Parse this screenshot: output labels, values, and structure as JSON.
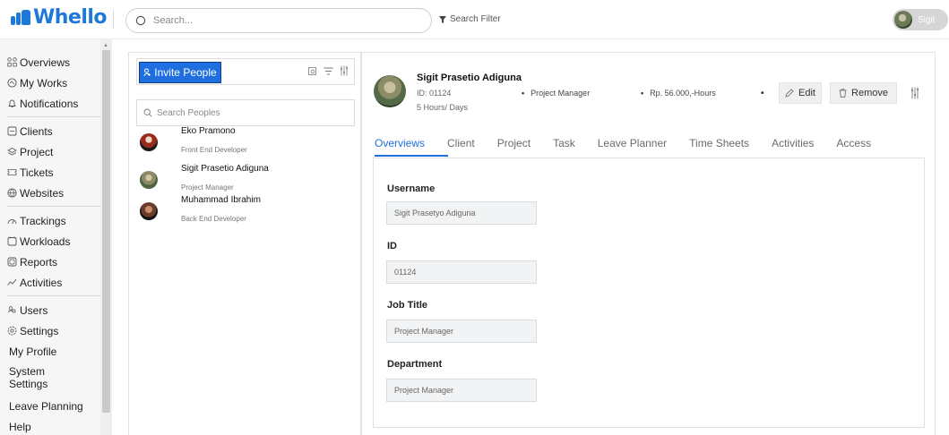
{
  "app": {
    "brand": "Whello",
    "search_placeholder": "Search...",
    "search_filter_label": "Search Filter",
    "user_name": "Sigit"
  },
  "sidebar": {
    "items": [
      {
        "label": "Overviews",
        "icon": "overview-icon"
      },
      {
        "label": "My Works",
        "icon": "my-works-icon"
      },
      {
        "label": "Notifications",
        "icon": "bell-icon"
      },
      {
        "label": "Clients",
        "icon": "clients-icon"
      },
      {
        "label": "Project",
        "icon": "project-icon"
      },
      {
        "label": "Tickets",
        "icon": "ticket-icon"
      },
      {
        "label": "Websites",
        "icon": "globe-icon"
      },
      {
        "label": "Trackings",
        "icon": "tracking-icon"
      },
      {
        "label": "Workloads",
        "icon": "workload-icon"
      },
      {
        "label": "Reports",
        "icon": "report-icon"
      },
      {
        "label": "Activities",
        "icon": "activity-icon"
      },
      {
        "label": "Users",
        "icon": "users-icon"
      },
      {
        "label": "Settings",
        "icon": "settings-icon"
      },
      {
        "label": "My Profile"
      },
      {
        "label": "System Settings"
      },
      {
        "label": "Leave Planning"
      },
      {
        "label": "Help"
      }
    ]
  },
  "people": {
    "invite_label": "Invite People",
    "search_placeholder": "Search Peoples",
    "list": [
      {
        "name": "Eko Pramono",
        "role": "Front End Developer"
      },
      {
        "name": "Sigit Prasetio Adiguna",
        "role": "Project Manager"
      },
      {
        "name": "Muhammad Ibrahim",
        "role": "Back End Developer"
      }
    ]
  },
  "profile": {
    "name": "Sigit Prasetio Adiguna",
    "id_text": "ID: 01124",
    "hours": "5 Hours/ Days",
    "position": "Project Manager",
    "rate": "Rp. 56.000,-Hours",
    "edit_label": "Edit",
    "remove_label": "Remove"
  },
  "tabs": [
    "Overviews",
    "Client",
    "Project",
    "Task",
    "Leave Planner",
    "Time Sheets",
    "Activities",
    "Access"
  ],
  "form": {
    "fields": [
      {
        "label": "Username",
        "value": "Sigit Prasetyo Adiguna"
      },
      {
        "label": "ID",
        "value": "01124"
      },
      {
        "label": "Job Title",
        "value": "Project Manager"
      },
      {
        "label": "Department",
        "value": "Project Manager"
      }
    ]
  },
  "colors": {
    "accent": "#1f6fe0",
    "brand": "#1d78d8"
  }
}
